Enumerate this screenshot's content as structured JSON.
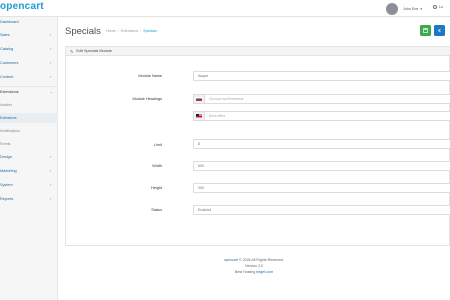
{
  "header": {
    "logo": "opencart",
    "user_name": "John Doe",
    "logout_label": "Lo"
  },
  "sidebar": {
    "items": [
      {
        "label": "Dashboard",
        "chevron": ""
      },
      {
        "label": "Sales",
        "chevron": "›"
      },
      {
        "label": "Catalog",
        "chevron": "›"
      },
      {
        "label": "Customers",
        "chevron": "›"
      },
      {
        "label": "Content",
        "chevron": "›"
      },
      {
        "label": "Extensions",
        "chevron": "⌄"
      }
    ],
    "sub_items": [
      "Installer",
      "Extensions",
      "Modifications",
      "Events"
    ],
    "items_after": [
      {
        "label": "Design",
        "chevron": "›"
      },
      {
        "label": "Marketing",
        "chevron": "›"
      },
      {
        "label": "System",
        "chevron": "›"
      },
      {
        "label": "Reports",
        "chevron": "›"
      }
    ]
  },
  "page": {
    "title": "Specials",
    "breadcrumb": [
      "Home",
      "Extensions",
      "Specials"
    ],
    "save_icon": "save-icon",
    "back_icon": "back-icon"
  },
  "card": {
    "heading": "Edit Specials Module",
    "fields": {
      "module_name": {
        "label": "Module Name",
        "value": "Акции"
      },
      "module_headings": {
        "label": "Module Headings",
        "ru_placeholder": "Лучшие предложения",
        "en_placeholder": "Best offers"
      },
      "limit": {
        "label": "Limit",
        "value": "8"
      },
      "width": {
        "label": "Width",
        "value": "600"
      },
      "height": {
        "label": "Height",
        "value": "350"
      },
      "status": {
        "label": "Status",
        "value": "Enabled"
      }
    }
  },
  "footer": {
    "line1_link": "opencart",
    "line1_text": "© 2026 All Rights Reserved.",
    "line2": "Version 3.0",
    "line3_text": "Best Hosting",
    "line3_link": "beget.com"
  },
  "colors": {
    "accent": "#1b9bd7",
    "save_button": "#3daa4b",
    "back_button": "#1e78c8"
  }
}
